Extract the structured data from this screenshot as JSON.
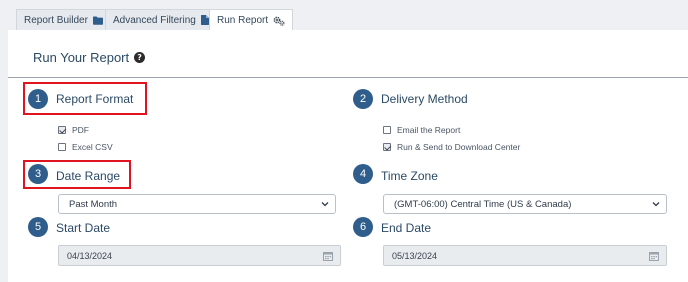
{
  "tabs": [
    {
      "label": "Report Builder",
      "icon": "folder-icon"
    },
    {
      "label": "Advanced Filtering",
      "icon": "file-icon"
    },
    {
      "label": "Run Report",
      "icon": "gears-icon"
    }
  ],
  "page": {
    "title": "Run Your Report",
    "help_icon": "question-circle-icon"
  },
  "sections": {
    "report_format": {
      "number": "1",
      "label": "Report Format",
      "options": [
        {
          "label": "PDF",
          "checked": true
        },
        {
          "label": "Excel CSV",
          "checked": false
        }
      ]
    },
    "delivery_method": {
      "number": "2",
      "label": "Delivery Method",
      "options": [
        {
          "label": "Email the Report",
          "checked": false
        },
        {
          "label": "Run & Send to Download Center",
          "checked": true
        }
      ]
    },
    "date_range": {
      "number": "3",
      "label": "Date Range",
      "value": "Past Month"
    },
    "time_zone": {
      "number": "4",
      "label": "Time Zone",
      "value": "(GMT-06:00) Central Time (US & Canada)"
    },
    "start_date": {
      "number": "5",
      "label": "Start Date",
      "value": "04/13/2024"
    },
    "end_date": {
      "number": "6",
      "label": "End Date",
      "value": "05/13/2024"
    }
  },
  "colors": {
    "step_badge": "#2f5d8c",
    "highlight": "#e0141e",
    "heading": "#2b4a66"
  }
}
